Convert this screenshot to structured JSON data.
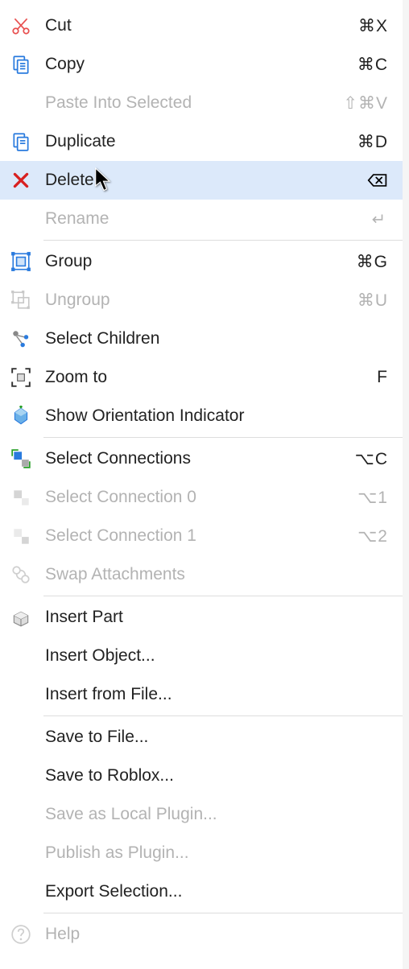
{
  "menu": {
    "cut": {
      "label": "Cut",
      "shortcut": "⌘X"
    },
    "copy": {
      "label": "Copy",
      "shortcut": "⌘C"
    },
    "paste_into": {
      "label": "Paste Into Selected",
      "shortcut": "⇧⌘V"
    },
    "duplicate": {
      "label": "Duplicate",
      "shortcut": "⌘D"
    },
    "delete": {
      "label": "Delete"
    },
    "rename": {
      "label": "Rename"
    },
    "group": {
      "label": "Group",
      "shortcut": "⌘G"
    },
    "ungroup": {
      "label": "Ungroup",
      "shortcut": "⌘U"
    },
    "select_children": {
      "label": "Select Children"
    },
    "zoom_to": {
      "label": "Zoom to",
      "shortcut": "F"
    },
    "show_orientation": {
      "label": "Show Orientation Indicator"
    },
    "select_connections": {
      "label": "Select Connections",
      "shortcut": "⌥C"
    },
    "select_connection_0": {
      "label": "Select Connection 0",
      "shortcut": "⌥1"
    },
    "select_connection_1": {
      "label": "Select Connection 1",
      "shortcut": "⌥2"
    },
    "swap_attachments": {
      "label": "Swap Attachments"
    },
    "insert_part": {
      "label": "Insert Part"
    },
    "insert_object": {
      "label": "Insert Object..."
    },
    "insert_from_file": {
      "label": "Insert from File..."
    },
    "save_to_file": {
      "label": "Save to File..."
    },
    "save_to_roblox": {
      "label": "Save to Roblox..."
    },
    "save_local_plugin": {
      "label": "Save as Local Plugin..."
    },
    "publish_plugin": {
      "label": "Publish as Plugin..."
    },
    "export_selection": {
      "label": "Export Selection..."
    },
    "help": {
      "label": "Help"
    }
  }
}
